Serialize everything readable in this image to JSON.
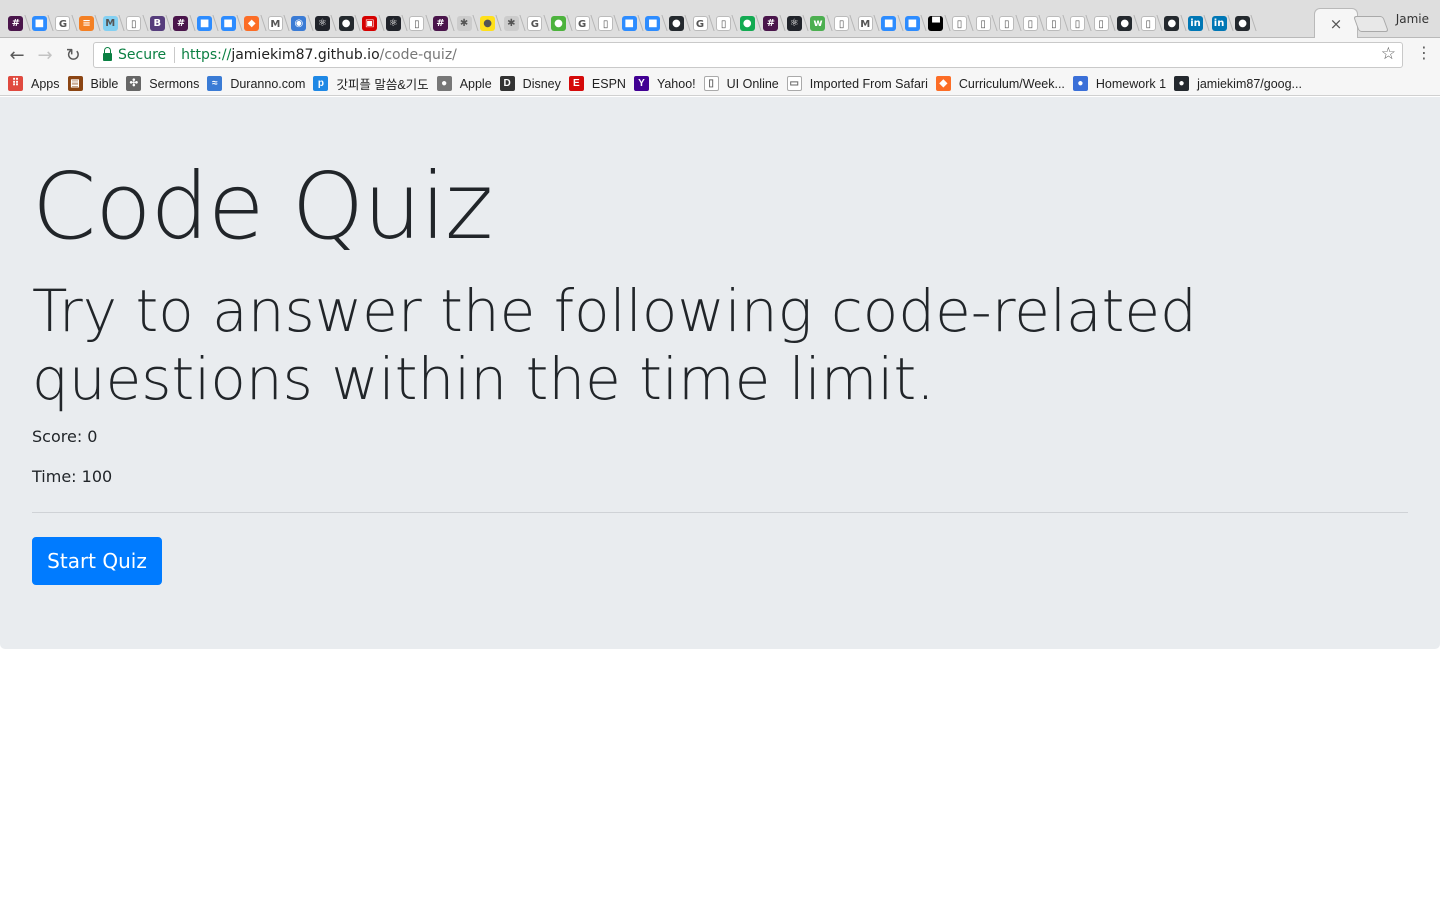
{
  "browser": {
    "profile_name": "Jamie",
    "active_tab_close": "×",
    "tab_favicons": [
      {
        "icon": "slack-icon",
        "color": "#4a154b",
        "glyph": "#"
      },
      {
        "icon": "zoom-icon",
        "color": "#2d8cff",
        "glyph": "■"
      },
      {
        "icon": "google-icon",
        "color": "#ffffff",
        "glyph": "G"
      },
      {
        "icon": "stackoverflow-icon",
        "color": "#f48024",
        "glyph": "≡"
      },
      {
        "icon": "mdn-icon",
        "color": "#83d0f2",
        "glyph": "M"
      },
      {
        "icon": "page-icon",
        "color": "#ffffff",
        "glyph": "▯"
      },
      {
        "icon": "bootstrap-icon",
        "color": "#563d7c",
        "glyph": "B"
      },
      {
        "icon": "slack-icon",
        "color": "#4a154b",
        "glyph": "#"
      },
      {
        "icon": "zoom-icon",
        "color": "#2d8cff",
        "glyph": "■"
      },
      {
        "icon": "zoom-icon",
        "color": "#2d8cff",
        "glyph": "■"
      },
      {
        "icon": "gitlab-icon",
        "color": "#fc6d26",
        "glyph": "◆"
      },
      {
        "icon": "medium-icon",
        "color": "#ffffff",
        "glyph": "M"
      },
      {
        "icon": "globe-icon",
        "color": "#3a7bd5",
        "glyph": "◉"
      },
      {
        "icon": "react-icon",
        "color": "#20232a",
        "glyph": "⚛"
      },
      {
        "icon": "github-icon",
        "color": "#24292e",
        "glyph": "●"
      },
      {
        "icon": "red-app-icon",
        "color": "#d50000",
        "glyph": "▣"
      },
      {
        "icon": "react-icon",
        "color": "#20232a",
        "glyph": "⚛"
      },
      {
        "icon": "page-icon",
        "color": "#ffffff",
        "glyph": "▯"
      },
      {
        "icon": "slack-icon",
        "color": "#4a154b",
        "glyph": "#"
      },
      {
        "icon": "gear-icon",
        "color": "#cccccc",
        "glyph": "✱"
      },
      {
        "icon": "mailchimp-icon",
        "color": "#ffe01b",
        "glyph": "●"
      },
      {
        "icon": "gear-icon",
        "color": "#cccccc",
        "glyph": "✱"
      },
      {
        "icon": "google-icon",
        "color": "#ffffff",
        "glyph": "G"
      },
      {
        "icon": "mongodb-icon",
        "color": "#4db33d",
        "glyph": "●"
      },
      {
        "icon": "google-icon",
        "color": "#ffffff",
        "glyph": "G"
      },
      {
        "icon": "page-icon",
        "color": "#ffffff",
        "glyph": "▯"
      },
      {
        "icon": "zoom-icon",
        "color": "#2d8cff",
        "glyph": "■"
      },
      {
        "icon": "zoom-icon",
        "color": "#2d8cff",
        "glyph": "■"
      },
      {
        "icon": "github-icon",
        "color": "#24292e",
        "glyph": "●"
      },
      {
        "icon": "google-icon",
        "color": "#ffffff",
        "glyph": "G"
      },
      {
        "icon": "page-icon",
        "color": "#ffffff",
        "glyph": "▯"
      },
      {
        "icon": "mongodb-icon",
        "color": "#13aa52",
        "glyph": "●"
      },
      {
        "icon": "slack-icon",
        "color": "#4a154b",
        "glyph": "#"
      },
      {
        "icon": "react-icon",
        "color": "#20232a",
        "glyph": "⚛"
      },
      {
        "icon": "w3-icon",
        "color": "#4caf50",
        "glyph": "w"
      },
      {
        "icon": "page-icon",
        "color": "#ffffff",
        "glyph": "▯"
      },
      {
        "icon": "gmail-icon",
        "color": "#ffffff",
        "glyph": "M"
      },
      {
        "icon": "zoom-icon",
        "color": "#2d8cff",
        "glyph": "■"
      },
      {
        "icon": "zoom-icon",
        "color": "#2d8cff",
        "glyph": "■"
      },
      {
        "icon": "unsplash-icon",
        "color": "#000000",
        "glyph": "▀"
      },
      {
        "icon": "page-icon",
        "color": "#ffffff",
        "glyph": "▯"
      },
      {
        "icon": "page-icon",
        "color": "#ffffff",
        "glyph": "▯"
      },
      {
        "icon": "page-icon",
        "color": "#ffffff",
        "glyph": "▯"
      },
      {
        "icon": "page-icon",
        "color": "#ffffff",
        "glyph": "▯"
      },
      {
        "icon": "page-icon",
        "color": "#ffffff",
        "glyph": "▯"
      },
      {
        "icon": "page-icon",
        "color": "#ffffff",
        "glyph": "▯"
      },
      {
        "icon": "page-icon",
        "color": "#ffffff",
        "glyph": "▯"
      },
      {
        "icon": "github-icon",
        "color": "#24292e",
        "glyph": "●"
      },
      {
        "icon": "page-icon",
        "color": "#ffffff",
        "glyph": "▯"
      },
      {
        "icon": "github-icon",
        "color": "#24292e",
        "glyph": "●"
      },
      {
        "icon": "linkedin-icon",
        "color": "#0077b5",
        "glyph": "in"
      },
      {
        "icon": "linkedin-icon",
        "color": "#0077b5",
        "glyph": "in"
      },
      {
        "icon": "github-icon",
        "color": "#24292e",
        "glyph": "●"
      }
    ]
  },
  "toolbar": {
    "back_icon": "←",
    "forward_icon": "→",
    "reload_icon": "↻",
    "secure_label": "Secure",
    "url_scheme": "https://",
    "url_host": "jamiekim87.github.io",
    "url_path": "/code-quiz/",
    "bookmark_star": "☆",
    "menu_icon": "⋮"
  },
  "bookmarks": [
    {
      "label": "Apps",
      "icon": "apps-grid-icon",
      "color": "#e04a3f",
      "glyph": "⠿"
    },
    {
      "label": "Bible",
      "icon": "bible-icon",
      "color": "#8b4513",
      "glyph": "▤"
    },
    {
      "label": "Sermons",
      "icon": "sermons-icon",
      "color": "#666666",
      "glyph": "✣"
    },
    {
      "label": "Duranno.com",
      "icon": "duranno-icon",
      "color": "#3a7bd5",
      "glyph": "≈"
    },
    {
      "label": "갓피플 말씀&기도",
      "icon": "godpeople-icon",
      "color": "#1e88e5",
      "glyph": "p"
    },
    {
      "label": "Apple",
      "icon": "apple-icon",
      "color": "#777777",
      "glyph": "●"
    },
    {
      "label": "Disney",
      "icon": "disney-icon",
      "color": "#333333",
      "glyph": "D"
    },
    {
      "label": "ESPN",
      "icon": "espn-icon",
      "color": "#d50a0a",
      "glyph": "E"
    },
    {
      "label": "Yahoo!",
      "icon": "yahoo-icon",
      "color": "#410093",
      "glyph": "Y"
    },
    {
      "label": "UI Online",
      "icon": "page-icon",
      "color": "#ffffff",
      "glyph": "▯"
    },
    {
      "label": "Imported From Safari",
      "icon": "folder-icon",
      "color": "#ffffff",
      "glyph": "▭"
    },
    {
      "label": "Curriculum/Week...",
      "icon": "gitlab-icon",
      "color": "#fc6d26",
      "glyph": "◆"
    },
    {
      "label": "Homework 1",
      "icon": "homework-icon",
      "color": "#3a6fd8",
      "glyph": "●"
    },
    {
      "label": "jamiekim87/goog...",
      "icon": "github-icon",
      "color": "#24292e",
      "glyph": "●"
    }
  ],
  "page": {
    "title": "Code Quiz",
    "lead": "Try to answer the following code-related questions within the time limit.",
    "score_text": "Score: 0",
    "time_text": "Time: 100",
    "start_button": "Start Quiz",
    "colors": {
      "jumbotron_bg": "#e9ecef",
      "primary": "#007bff",
      "text": "#212529"
    }
  }
}
